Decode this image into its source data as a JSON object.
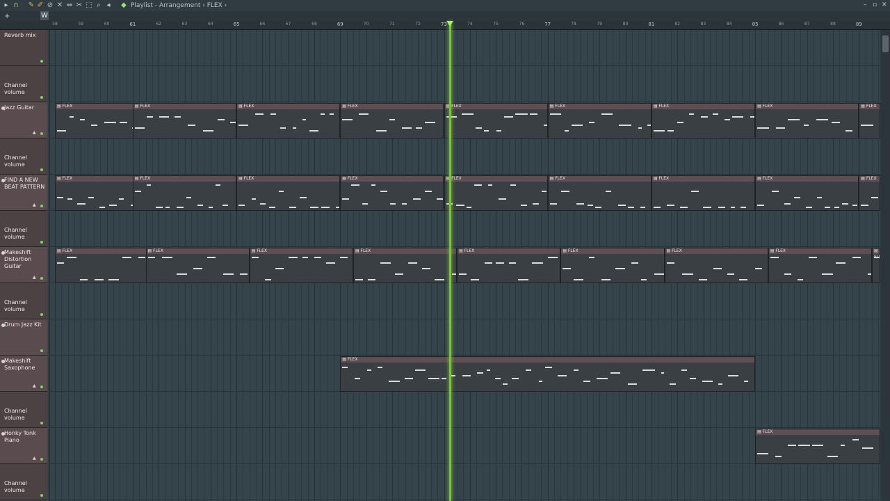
{
  "window": {
    "title": "Playlist - Arrangement",
    "pattern": "FLEX",
    "arrow": "›"
  },
  "toolbar": {
    "icons": [
      "menu-icon",
      "snap-magnet-icon",
      "draw-icon",
      "paint-icon",
      "delete-icon",
      "mute-icon",
      "slip-icon",
      "slice-icon",
      "select-icon",
      "zoom-icon",
      "playback-icon"
    ],
    "browse_label": "W"
  },
  "ruler": {
    "bars": [
      "58",
      "59",
      "60",
      "61",
      "62",
      "63",
      "64",
      "65",
      "66",
      "67",
      "68",
      "69",
      "70",
      "71",
      "72",
      "73",
      "74",
      "75",
      "76",
      "77",
      "78",
      "79",
      "80",
      "81",
      "82",
      "83",
      "84",
      "85",
      "86",
      "87",
      "88",
      "89"
    ],
    "major_every": 4,
    "first_major": "61"
  },
  "tracks": [
    {
      "label": "Reverb mix",
      "type": "auto"
    },
    {
      "label": "Channel volume",
      "type": "auto"
    },
    {
      "label": "Jazz Guitar",
      "type": "inst"
    },
    {
      "label": "Channel volume",
      "type": "auto"
    },
    {
      "label": "FIND A NEW\nBEAT PATTERN",
      "type": "inst"
    },
    {
      "label": "Channel volume",
      "type": "auto"
    },
    {
      "label": "Makeshift\nDistortion Guitar",
      "type": "inst"
    },
    {
      "label": "Channel volume",
      "type": "auto"
    },
    {
      "label": "Drum Jazz Kit",
      "type": "inst"
    },
    {
      "label": "Makeshift\nSaxophone",
      "type": "inst"
    },
    {
      "label": "Channel volume",
      "type": "auto"
    },
    {
      "label": "Honky Tonk\nPiano",
      "type": "inst"
    },
    {
      "label": "Channel volume",
      "type": "auto"
    }
  ],
  "clip_label": "FLEX",
  "colors": {
    "accent": "#7ac13c",
    "clip_header": "#5c4e51",
    "grid": "#35434b"
  },
  "playhead_bar": 73.2
}
